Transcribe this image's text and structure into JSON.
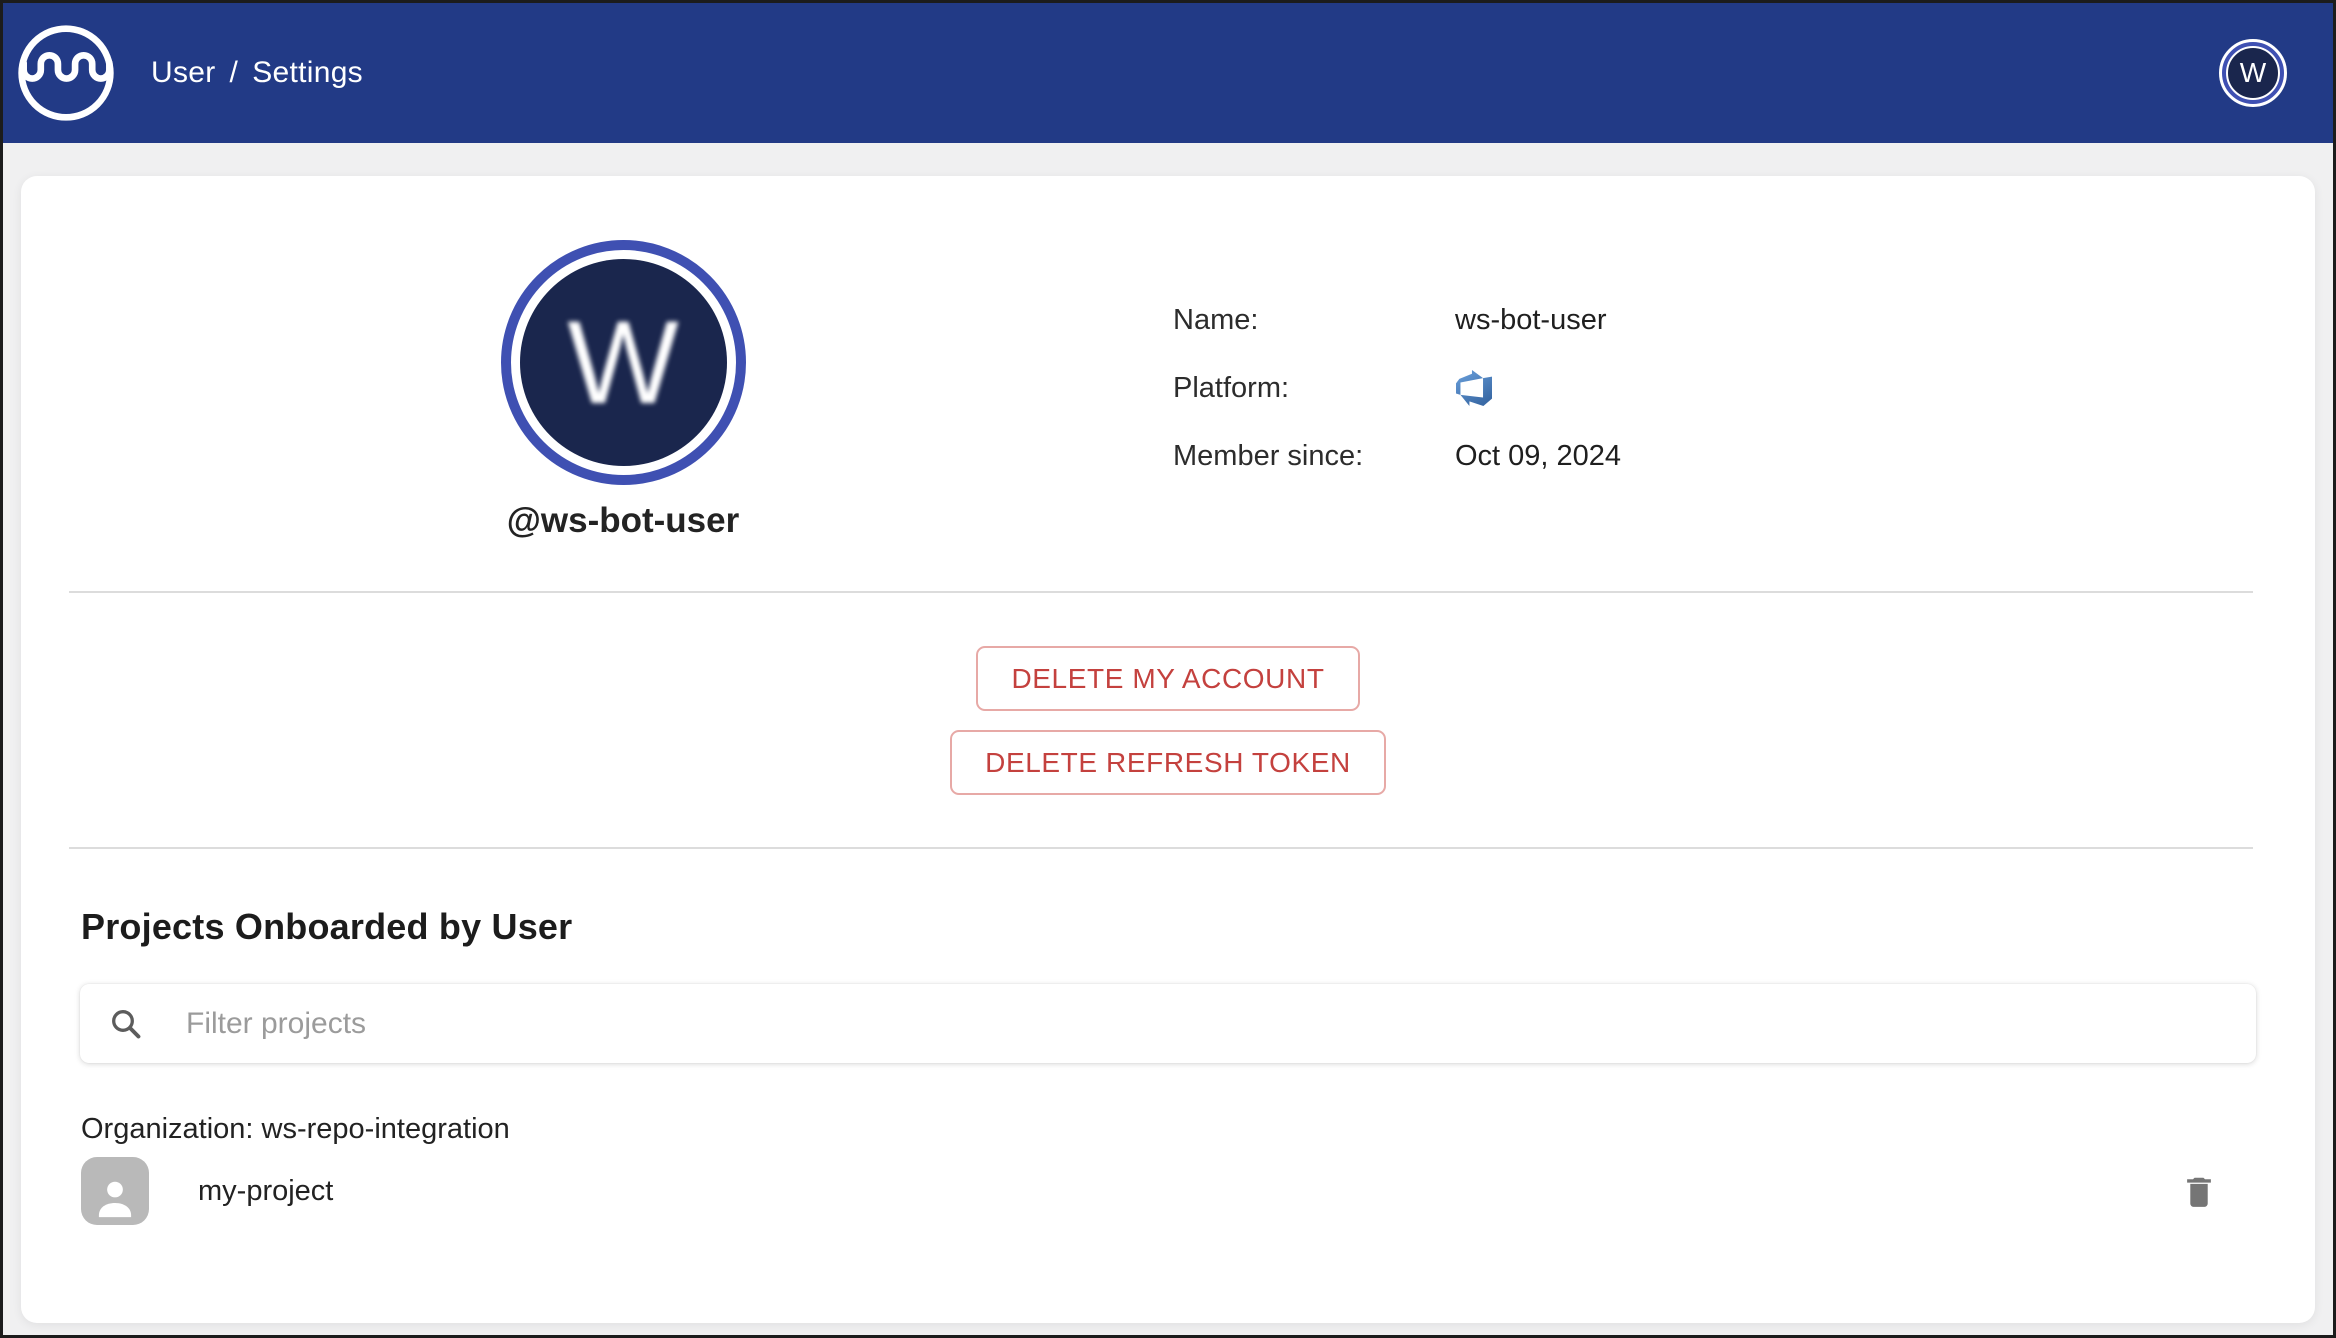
{
  "colors": {
    "header_bg": "#223a86",
    "avatar_ring": "#3f50b2",
    "avatar_center": "#1a264d",
    "danger_text": "#c4413e",
    "danger_border": "#e7a9a6",
    "divider": "#dcdcdc",
    "icon_gray": "#757575",
    "project_avatar_bg": "#b9b9b9"
  },
  "icons": {
    "logo": "mend-wave-logo",
    "platform": "azure-devops-icon",
    "filter": "search-icon",
    "project": "person-icon",
    "delete_project": "trash-icon"
  },
  "header": {
    "breadcrumb": {
      "items": [
        "User",
        "Settings"
      ],
      "separator": "/"
    },
    "avatar_letter": "W"
  },
  "profile": {
    "avatar_letter": "W",
    "username": "@ws-bot-user",
    "fields": [
      {
        "label": "Name:",
        "value": "ws-bot-user"
      },
      {
        "label": "Platform:",
        "value": ""
      },
      {
        "label": "Member since:",
        "value": "Oct 09, 2024"
      }
    ]
  },
  "actions": {
    "delete_account_label": "DELETE MY ACCOUNT",
    "delete_refresh_token_label": "DELETE REFRESH TOKEN"
  },
  "projects": {
    "section_title": "Projects Onboarded by User",
    "filter_placeholder": "Filter projects",
    "organization_label": "Organization: ws-repo-integration",
    "items": [
      {
        "name": "my-project"
      }
    ]
  }
}
